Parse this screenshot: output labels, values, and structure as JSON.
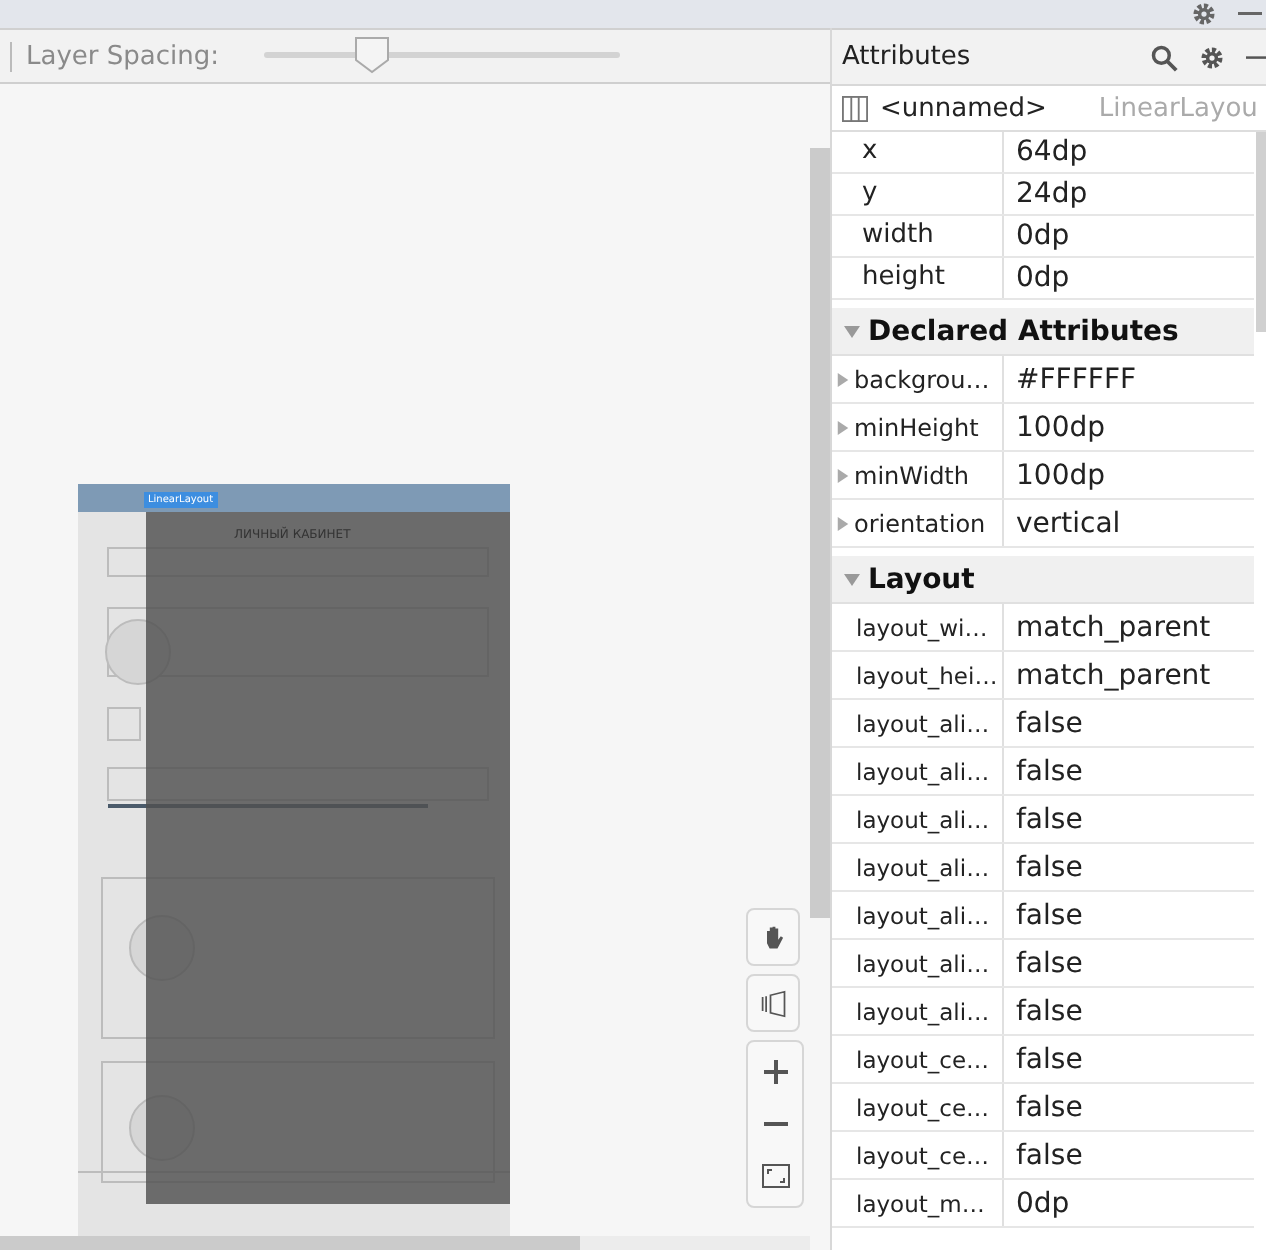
{
  "toolbar": {
    "label": "Layer Spacing:",
    "slider": {
      "level": 0.3
    }
  },
  "preview": {
    "selection_label": "LinearLayout",
    "screen_title": "ЛИЧНЫЙ КАБИНЕТ"
  },
  "attributes": {
    "title": "Attributes",
    "component": {
      "name": "<unnamed>",
      "type": "LinearLayou"
    },
    "bounds": [
      {
        "label": "x",
        "value": "64dp"
      },
      {
        "label": "y",
        "value": "24dp"
      },
      {
        "label": "width",
        "value": "0dp"
      },
      {
        "label": "height",
        "value": "0dp"
      }
    ],
    "sections": [
      {
        "title": "Declared Attributes",
        "expanded": true,
        "rows": [
          {
            "label": "backgrou…",
            "value": "#FFFFFF",
            "expandable": true
          },
          {
            "label": "minHeight",
            "value": "100dp",
            "expandable": true
          },
          {
            "label": "minWidth",
            "value": "100dp",
            "expandable": true
          },
          {
            "label": "orientation",
            "value": "vertical",
            "expandable": true
          }
        ]
      },
      {
        "title": "Layout",
        "expanded": true,
        "rows": [
          {
            "label": "layout_wi…",
            "value": "match_parent",
            "expandable": false
          },
          {
            "label": "layout_hei…",
            "value": "match_parent",
            "expandable": false
          },
          {
            "label": "layout_ali…",
            "value": "false",
            "expandable": false
          },
          {
            "label": "layout_ali…",
            "value": "false",
            "expandable": false
          },
          {
            "label": "layout_ali…",
            "value": "false",
            "expandable": false
          },
          {
            "label": "layout_ali…",
            "value": "false",
            "expandable": false
          },
          {
            "label": "layout_ali…",
            "value": "false",
            "expandable": false
          },
          {
            "label": "layout_ali…",
            "value": "false",
            "expandable": false
          },
          {
            "label": "layout_ali…",
            "value": "false",
            "expandable": false
          },
          {
            "label": "layout_ce…",
            "value": "false",
            "expandable": false
          },
          {
            "label": "layout_ce…",
            "value": "false",
            "expandable": false
          },
          {
            "label": "layout_ce…",
            "value": "false",
            "expandable": false
          },
          {
            "label": "layout_m…",
            "value": "0dp",
            "expandable": false
          }
        ]
      }
    ]
  }
}
